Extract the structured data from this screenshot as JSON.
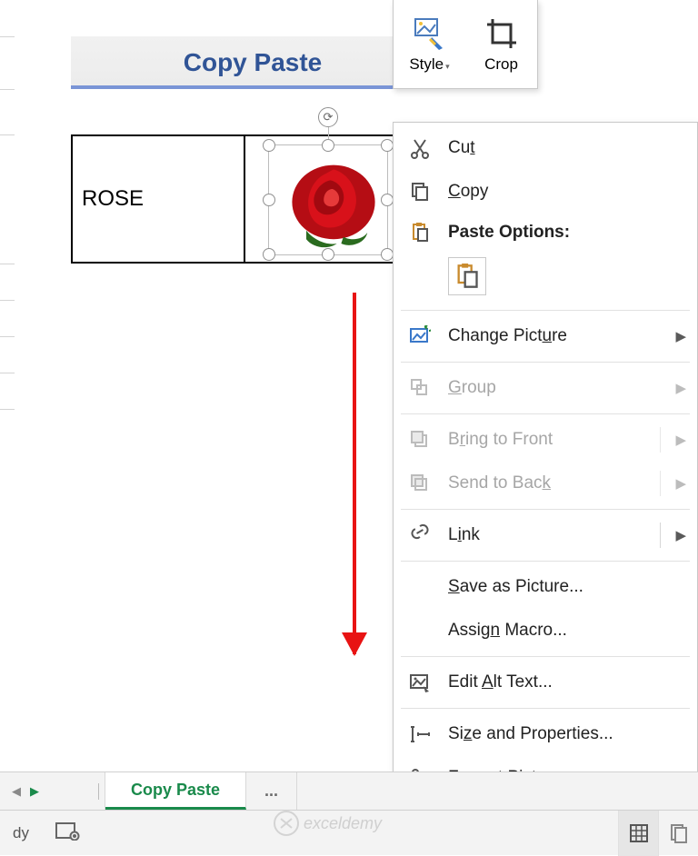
{
  "header": {
    "title": "Copy Paste"
  },
  "table": {
    "label": "ROSE",
    "image_name": "rose"
  },
  "mini_toolbar": {
    "style": "Style",
    "crop": "Crop"
  },
  "context_menu": {
    "cut": "Cut",
    "copy": "Copy",
    "paste_options": "Paste Options:",
    "change_picture": "Change Picture",
    "group": "Group",
    "bring_front": "Bring to Front",
    "send_back": "Send to Back",
    "link": "Link",
    "save_as_picture": "Save as Picture...",
    "assign_macro": "Assign Macro...",
    "edit_alt_text": "Edit Alt Text...",
    "size_properties": "Size and Properties...",
    "format_picture": "Format Picture..."
  },
  "tabs": {
    "active": "Copy Paste",
    "overflow": "..."
  },
  "status": {
    "ready": "dy"
  },
  "watermark": {
    "text": "exceldemy"
  }
}
